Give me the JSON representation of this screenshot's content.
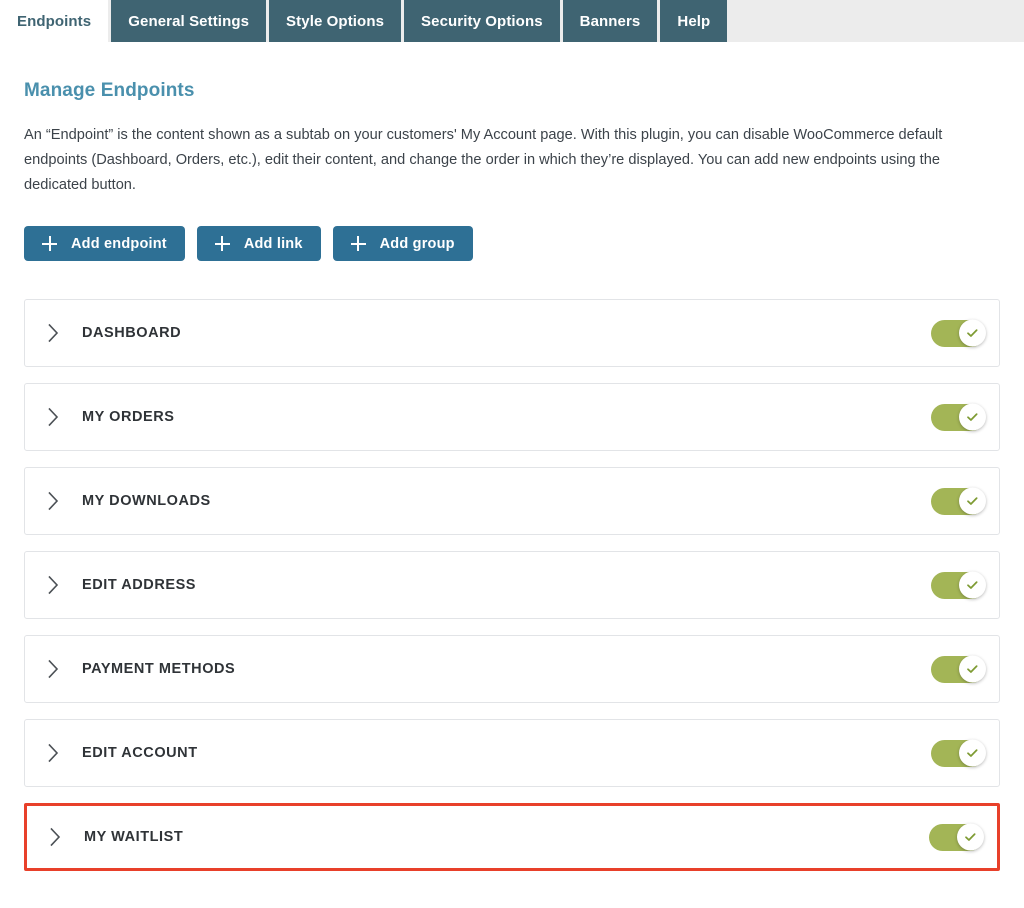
{
  "tabs": [
    {
      "label": "Endpoints",
      "active": true
    },
    {
      "label": "General Settings",
      "active": false
    },
    {
      "label": "Style Options",
      "active": false
    },
    {
      "label": "Security Options",
      "active": false
    },
    {
      "label": "Banners",
      "active": false
    },
    {
      "label": "Help",
      "active": false
    }
  ],
  "page": {
    "title": "Manage Endpoints",
    "description": "An “Endpoint” is the content shown as a subtab on your customers' My Account page. With this plugin, you can disable WooCommerce default endpoints (Dashboard, Orders, etc.), edit their content, and change the order in which they’re displayed. You can add new endpoints using the dedicated button."
  },
  "actions": [
    {
      "label": "Add endpoint",
      "icon": "plus-icon"
    },
    {
      "label": "Add link",
      "icon": "plus-icon"
    },
    {
      "label": "Add group",
      "icon": "plus-icon"
    }
  ],
  "endpoints": [
    {
      "label": "Dashboard",
      "enabled": true,
      "highlighted": false
    },
    {
      "label": "My Orders",
      "enabled": true,
      "highlighted": false
    },
    {
      "label": "My Downloads",
      "enabled": true,
      "highlighted": false
    },
    {
      "label": "Edit Address",
      "enabled": true,
      "highlighted": false
    },
    {
      "label": "Payment Methods",
      "enabled": true,
      "highlighted": false
    },
    {
      "label": "Edit Account",
      "enabled": true,
      "highlighted": false
    },
    {
      "label": "My Waitlist",
      "enabled": true,
      "highlighted": true
    }
  ],
  "colors": {
    "tab_active_text": "#3f6472",
    "tab_inactive_bg": "#3f6472",
    "tab_bar_bg": "#ececec",
    "heading": "#4a90ad",
    "button": "#2e7095",
    "toggle_on": "#a3b556",
    "toggle_check": "#7e9b33",
    "highlight_border": "#e8402a"
  }
}
